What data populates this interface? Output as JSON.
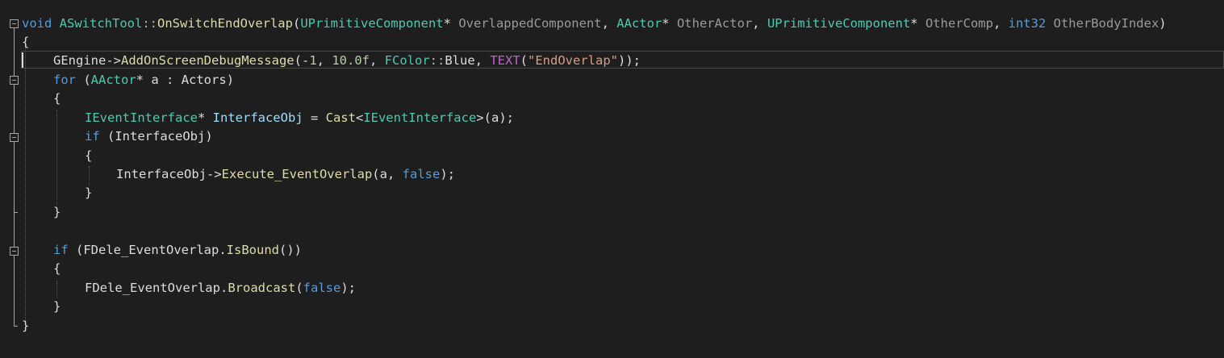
{
  "colors": {
    "background": "#1e1e1e",
    "keyword": "#569cd6",
    "type": "#4ec9b0",
    "function": "#dcdcaa",
    "parameter": "#9a9a9a",
    "plain": "#dcdcdc",
    "number": "#b5cea8",
    "string": "#d69d85",
    "macro": "#bd63c5",
    "variable": "#9cdcfe"
  },
  "code": {
    "l1": {
      "t1": "void",
      "t2": " ",
      "t3": "ASwitchTool",
      "t4": "::",
      "t5": "OnSwitchEndOverlap",
      "t6": "(",
      "t7": "UPrimitiveComponent",
      "t8": "* ",
      "t9": "OverlappedComponent",
      "t10": ", ",
      "t11": "AActor",
      "t12": "* ",
      "t13": "OtherActor",
      "t14": ", ",
      "t15": "UPrimitiveComponent",
      "t16": "* ",
      "t17": "OtherComp",
      "t18": ", ",
      "t19": "int32",
      "t20": " ",
      "t21": "OtherBodyIndex",
      "t22": ")"
    },
    "l2": {
      "t1": "{"
    },
    "l3": {
      "t1": "GEngine",
      "t2": "->",
      "t3": "AddOnScreenDebugMessage",
      "t4": "(-",
      "t5": "1",
      "t6": ", ",
      "t7": "10.0f",
      "t8": ", ",
      "t9": "FColor",
      "t10": "::",
      "t11": "Blue",
      "t12": ", ",
      "t13": "TEXT",
      "t14": "(",
      "t15": "\"EndOverlap\"",
      "t16": "));"
    },
    "l4": {
      "t1": "for",
      "t2": " (",
      "t3": "AActor",
      "t4": "* ",
      "t5": "a",
      "t6": " : ",
      "t7": "Actors",
      "t8": ")"
    },
    "l5": {
      "t1": "{"
    },
    "l6": {
      "t1": "IEventInterface",
      "t2": "* ",
      "t3": "InterfaceObj",
      "t4": " = ",
      "t5": "Cast",
      "t6": "<",
      "t7": "IEventInterface",
      "t8": ">(",
      "t9": "a",
      "t10": ");"
    },
    "l7": {
      "t1": "if",
      "t2": " (",
      "t3": "InterfaceObj",
      "t4": ")"
    },
    "l8": {
      "t1": "{"
    },
    "l9": {
      "t1": "InterfaceObj",
      "t2": "->",
      "t3": "Execute_EventOverlap",
      "t4": "(",
      "t5": "a",
      "t6": ", ",
      "t7": "false",
      "t8": ");"
    },
    "l10": {
      "t1": "}"
    },
    "l11": {
      "t1": "}"
    },
    "l13": {
      "t1": "if",
      "t2": " (",
      "t3": "FDele_EventOverlap",
      "t4": ".",
      "t5": "IsBound",
      "t6": "())"
    },
    "l14": {
      "t1": "{"
    },
    "l15": {
      "t1": "FDele_EventOverlap",
      "t2": ".",
      "t3": "Broadcast",
      "t4": "(",
      "t5": "false",
      "t6": ");"
    },
    "l16": {
      "t1": "}"
    },
    "l17": {
      "t1": "}"
    }
  }
}
